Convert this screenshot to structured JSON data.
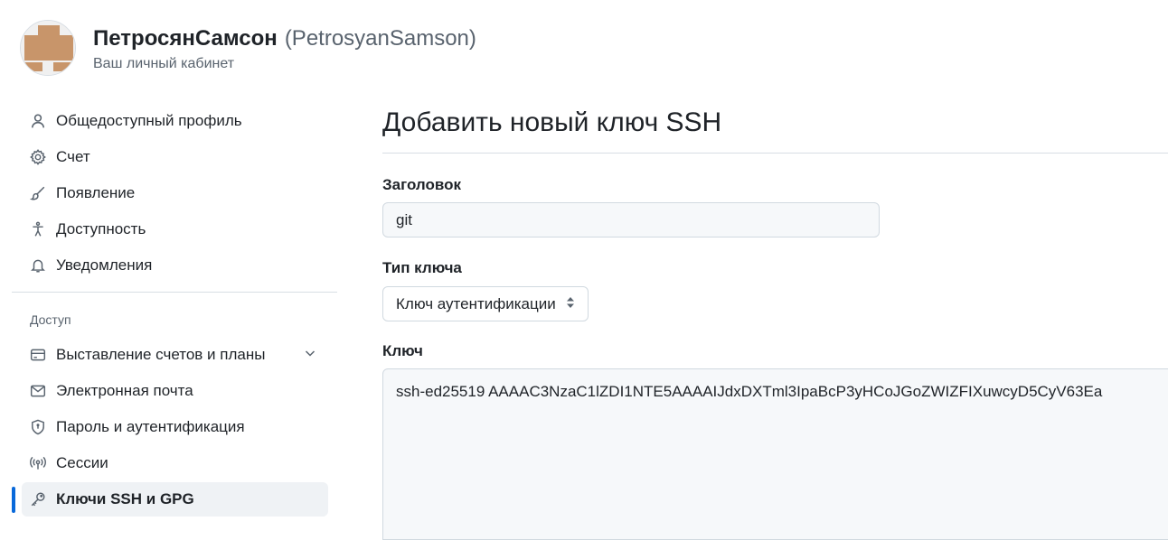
{
  "header": {
    "display_name": "ПетросянСамсон",
    "login": "(PetrosyanSamson)",
    "subtitle": "Ваш личный кабинет"
  },
  "sidebar": {
    "items": [
      {
        "label": "Общедоступный профиль",
        "icon": "person-icon"
      },
      {
        "label": "Счет",
        "icon": "gear-icon"
      },
      {
        "label": "Появление",
        "icon": "paintbrush-icon"
      },
      {
        "label": "Доступность",
        "icon": "accessibility-icon"
      },
      {
        "label": "Уведомления",
        "icon": "bell-icon"
      }
    ],
    "group_label": "Доступ",
    "access_items": [
      {
        "label": "Выставление счетов и планы",
        "icon": "credit-card-icon"
      },
      {
        "label": "Электронная почта",
        "icon": "mail-icon"
      },
      {
        "label": "Пароль и аутентификация",
        "icon": "shield-lock-icon"
      },
      {
        "label": "Сессии",
        "icon": "broadcast-icon"
      },
      {
        "label": "Ключи SSH и GPG",
        "icon": "key-icon",
        "active": true
      }
    ]
  },
  "main": {
    "title": "Добавить новый ключ SSH",
    "title_field": {
      "label": "Заголовок",
      "value": "git"
    },
    "key_type": {
      "label": "Тип ключа",
      "selected": "Ключ аутентификации"
    },
    "key_field": {
      "label": "Ключ",
      "value": "ssh-ed25519 AAAAC3NzaC1lZDI1NTE5AAAAIJdxDXTml3IpaBcP3yHCoJGoZWIZFIXuwcyD5CyV63Ea"
    }
  },
  "colors": {
    "accent": "#0969da",
    "avatar": "#c8956a"
  }
}
